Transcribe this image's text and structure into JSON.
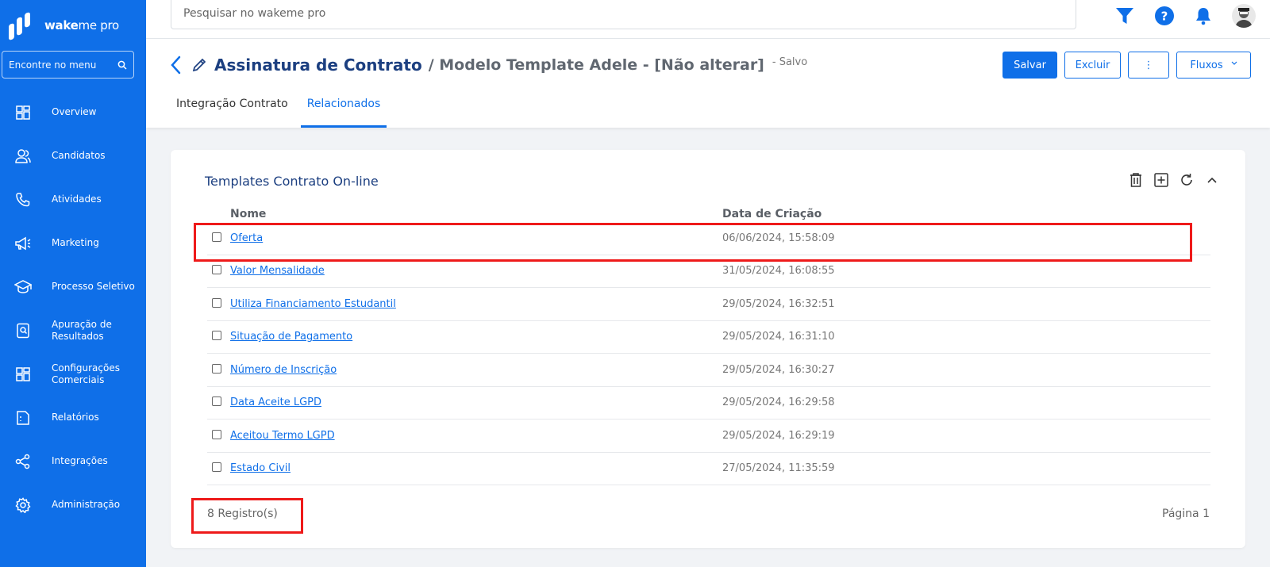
{
  "app": {
    "brand_bold": "wake",
    "brand_rest": "me pro",
    "brand_color": "#0f6fe8"
  },
  "sidebar": {
    "search_placeholder": "Encontre no menu",
    "items": [
      {
        "label": "Overview",
        "icon": "dashboard-icon"
      },
      {
        "label": "Candidatos",
        "icon": "users-icon"
      },
      {
        "label": "Atividades",
        "icon": "phone-icon"
      },
      {
        "label": "Marketing",
        "icon": "megaphone-icon"
      },
      {
        "label": "Processo Seletivo",
        "icon": "graduation-cap-icon"
      },
      {
        "label": "Apuração de Resultados",
        "icon": "search-document-icon"
      },
      {
        "label": "Configurações Comerciais",
        "icon": "grid-icon"
      },
      {
        "label": "Relatórios",
        "icon": "report-icon"
      },
      {
        "label": "Integrações",
        "icon": "share-icon"
      },
      {
        "label": "Administração",
        "icon": "gear-icon"
      }
    ]
  },
  "topbar": {
    "search_placeholder": "Pesquisar no wakeme pro"
  },
  "header": {
    "title": "Assinatura de Contrato",
    "subtitle": "/ Modelo Template Adele - [Não alterar]",
    "status": "- Salvo",
    "buttons": {
      "save": "Salvar",
      "delete": "Excluir",
      "more": "⋮",
      "flows": "Fluxos"
    },
    "tabs": [
      {
        "label": "Integração Contrato",
        "active": false
      },
      {
        "label": "Relacionados",
        "active": true
      }
    ]
  },
  "card": {
    "title": "Templates Contrato On-line",
    "columns": {
      "name": "Nome",
      "date": "Data de Criação"
    },
    "rows": [
      {
        "name": "Oferta",
        "date": "06/06/2024, 15:58:09"
      },
      {
        "name": "Valor Mensalidade",
        "date": "31/05/2024, 16:08:55"
      },
      {
        "name": "Utiliza Financiamento Estudantil",
        "date": "29/05/2024, 16:32:51"
      },
      {
        "name": "Situação de Pagamento",
        "date": "29/05/2024, 16:31:10"
      },
      {
        "name": "Número de Inscrição",
        "date": "29/05/2024, 16:30:27"
      },
      {
        "name": "Data Aceite LGPD",
        "date": "29/05/2024, 16:29:58"
      },
      {
        "name": "Aceitou Termo LGPD",
        "date": "29/05/2024, 16:29:19"
      },
      {
        "name": "Estado Civil",
        "date": "27/05/2024, 11:35:59"
      }
    ],
    "count": "8 Registro(s)",
    "page": "Página 1"
  },
  "highlight_color": "#ee1a1a"
}
